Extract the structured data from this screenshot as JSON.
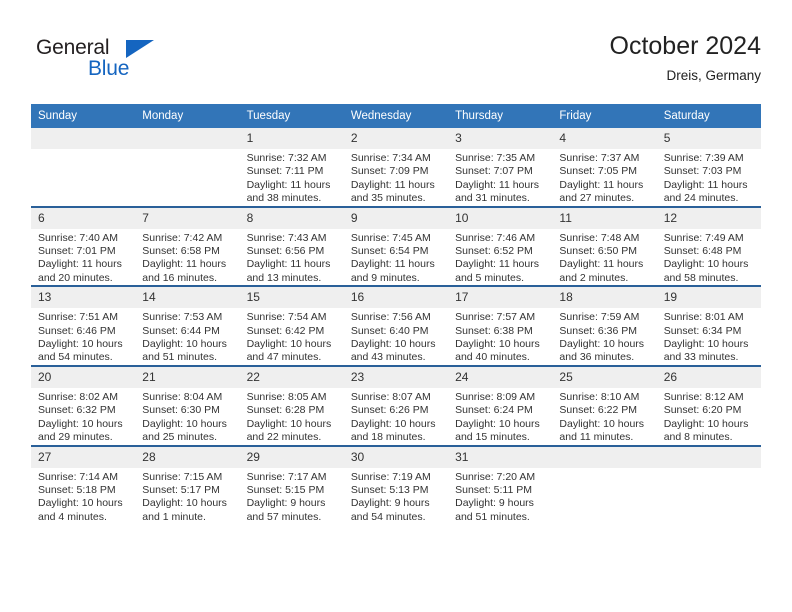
{
  "brand": {
    "name_dark": "General",
    "name_blue": "Blue",
    "triangle_color": "#1565c0"
  },
  "header": {
    "title": "October 2024",
    "subtitle": "Dreis, Germany"
  },
  "theme": {
    "header_bg": "#3275b8",
    "row_divider": "#2a6099",
    "daynum_bg": "#efefef"
  },
  "weekdays": [
    "Sunday",
    "Monday",
    "Tuesday",
    "Wednesday",
    "Thursday",
    "Friday",
    "Saturday"
  ],
  "weeks": [
    [
      {
        "day": "",
        "empty": true,
        "sunrise": "",
        "sunset": "",
        "daylight": ""
      },
      {
        "day": "",
        "empty": true,
        "sunrise": "",
        "sunset": "",
        "daylight": ""
      },
      {
        "day": "1",
        "sunrise": "Sunrise: 7:32 AM",
        "sunset": "Sunset: 7:11 PM",
        "daylight": "Daylight: 11 hours and 38 minutes."
      },
      {
        "day": "2",
        "sunrise": "Sunrise: 7:34 AM",
        "sunset": "Sunset: 7:09 PM",
        "daylight": "Daylight: 11 hours and 35 minutes."
      },
      {
        "day": "3",
        "sunrise": "Sunrise: 7:35 AM",
        "sunset": "Sunset: 7:07 PM",
        "daylight": "Daylight: 11 hours and 31 minutes."
      },
      {
        "day": "4",
        "sunrise": "Sunrise: 7:37 AM",
        "sunset": "Sunset: 7:05 PM",
        "daylight": "Daylight: 11 hours and 27 minutes."
      },
      {
        "day": "5",
        "sunrise": "Sunrise: 7:39 AM",
        "sunset": "Sunset: 7:03 PM",
        "daylight": "Daylight: 11 hours and 24 minutes."
      }
    ],
    [
      {
        "day": "6",
        "sunrise": "Sunrise: 7:40 AM",
        "sunset": "Sunset: 7:01 PM",
        "daylight": "Daylight: 11 hours and 20 minutes."
      },
      {
        "day": "7",
        "sunrise": "Sunrise: 7:42 AM",
        "sunset": "Sunset: 6:58 PM",
        "daylight": "Daylight: 11 hours and 16 minutes."
      },
      {
        "day": "8",
        "sunrise": "Sunrise: 7:43 AM",
        "sunset": "Sunset: 6:56 PM",
        "daylight": "Daylight: 11 hours and 13 minutes."
      },
      {
        "day": "9",
        "sunrise": "Sunrise: 7:45 AM",
        "sunset": "Sunset: 6:54 PM",
        "daylight": "Daylight: 11 hours and 9 minutes."
      },
      {
        "day": "10",
        "sunrise": "Sunrise: 7:46 AM",
        "sunset": "Sunset: 6:52 PM",
        "daylight": "Daylight: 11 hours and 5 minutes."
      },
      {
        "day": "11",
        "sunrise": "Sunrise: 7:48 AM",
        "sunset": "Sunset: 6:50 PM",
        "daylight": "Daylight: 11 hours and 2 minutes."
      },
      {
        "day": "12",
        "sunrise": "Sunrise: 7:49 AM",
        "sunset": "Sunset: 6:48 PM",
        "daylight": "Daylight: 10 hours and 58 minutes."
      }
    ],
    [
      {
        "day": "13",
        "sunrise": "Sunrise: 7:51 AM",
        "sunset": "Sunset: 6:46 PM",
        "daylight": "Daylight: 10 hours and 54 minutes."
      },
      {
        "day": "14",
        "sunrise": "Sunrise: 7:53 AM",
        "sunset": "Sunset: 6:44 PM",
        "daylight": "Daylight: 10 hours and 51 minutes."
      },
      {
        "day": "15",
        "sunrise": "Sunrise: 7:54 AM",
        "sunset": "Sunset: 6:42 PM",
        "daylight": "Daylight: 10 hours and 47 minutes."
      },
      {
        "day": "16",
        "sunrise": "Sunrise: 7:56 AM",
        "sunset": "Sunset: 6:40 PM",
        "daylight": "Daylight: 10 hours and 43 minutes."
      },
      {
        "day": "17",
        "sunrise": "Sunrise: 7:57 AM",
        "sunset": "Sunset: 6:38 PM",
        "daylight": "Daylight: 10 hours and 40 minutes."
      },
      {
        "day": "18",
        "sunrise": "Sunrise: 7:59 AM",
        "sunset": "Sunset: 6:36 PM",
        "daylight": "Daylight: 10 hours and 36 minutes."
      },
      {
        "day": "19",
        "sunrise": "Sunrise: 8:01 AM",
        "sunset": "Sunset: 6:34 PM",
        "daylight": "Daylight: 10 hours and 33 minutes."
      }
    ],
    [
      {
        "day": "20",
        "sunrise": "Sunrise: 8:02 AM",
        "sunset": "Sunset: 6:32 PM",
        "daylight": "Daylight: 10 hours and 29 minutes."
      },
      {
        "day": "21",
        "sunrise": "Sunrise: 8:04 AM",
        "sunset": "Sunset: 6:30 PM",
        "daylight": "Daylight: 10 hours and 25 minutes."
      },
      {
        "day": "22",
        "sunrise": "Sunrise: 8:05 AM",
        "sunset": "Sunset: 6:28 PM",
        "daylight": "Daylight: 10 hours and 22 minutes."
      },
      {
        "day": "23",
        "sunrise": "Sunrise: 8:07 AM",
        "sunset": "Sunset: 6:26 PM",
        "daylight": "Daylight: 10 hours and 18 minutes."
      },
      {
        "day": "24",
        "sunrise": "Sunrise: 8:09 AM",
        "sunset": "Sunset: 6:24 PM",
        "daylight": "Daylight: 10 hours and 15 minutes."
      },
      {
        "day": "25",
        "sunrise": "Sunrise: 8:10 AM",
        "sunset": "Sunset: 6:22 PM",
        "daylight": "Daylight: 10 hours and 11 minutes."
      },
      {
        "day": "26",
        "sunrise": "Sunrise: 8:12 AM",
        "sunset": "Sunset: 6:20 PM",
        "daylight": "Daylight: 10 hours and 8 minutes."
      }
    ],
    [
      {
        "day": "27",
        "sunrise": "Sunrise: 7:14 AM",
        "sunset": "Sunset: 5:18 PM",
        "daylight": "Daylight: 10 hours and 4 minutes."
      },
      {
        "day": "28",
        "sunrise": "Sunrise: 7:15 AM",
        "sunset": "Sunset: 5:17 PM",
        "daylight": "Daylight: 10 hours and 1 minute."
      },
      {
        "day": "29",
        "sunrise": "Sunrise: 7:17 AM",
        "sunset": "Sunset: 5:15 PM",
        "daylight": "Daylight: 9 hours and 57 minutes."
      },
      {
        "day": "30",
        "sunrise": "Sunrise: 7:19 AM",
        "sunset": "Sunset: 5:13 PM",
        "daylight": "Daylight: 9 hours and 54 minutes."
      },
      {
        "day": "31",
        "sunrise": "Sunrise: 7:20 AM",
        "sunset": "Sunset: 5:11 PM",
        "daylight": "Daylight: 9 hours and 51 minutes."
      },
      {
        "day": "",
        "empty": true,
        "sunrise": "",
        "sunset": "",
        "daylight": ""
      },
      {
        "day": "",
        "empty": true,
        "sunrise": "",
        "sunset": "",
        "daylight": ""
      }
    ]
  ]
}
